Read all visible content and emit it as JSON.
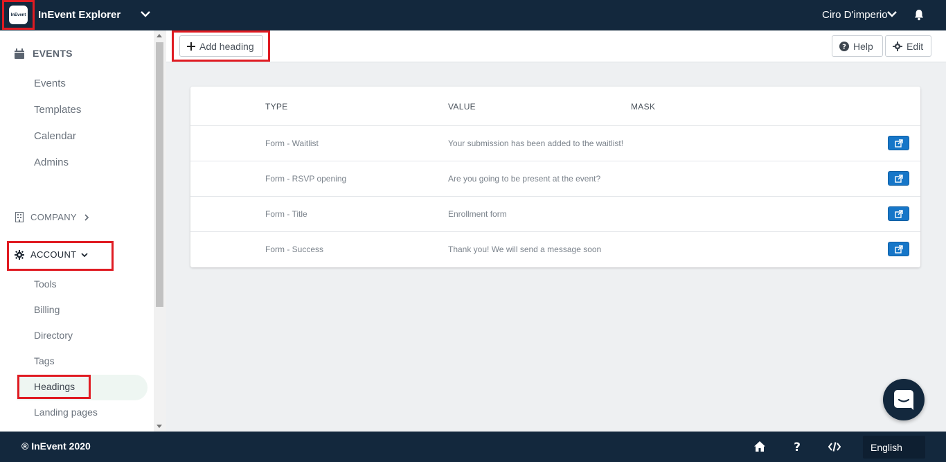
{
  "topbar": {
    "app_name": "InEvent Explorer",
    "logo_text": "InEvent",
    "user_name": "Ciro D'imperio"
  },
  "sidebar": {
    "events_section": "EVENTS",
    "events_items": [
      "Events",
      "Templates",
      "Calendar",
      "Admins"
    ],
    "company_section": "COMPANY",
    "account_section": "ACCOUNT",
    "account_items": [
      "Tools",
      "Billing",
      "Directory",
      "Tags",
      "Headings",
      "Landing pages"
    ],
    "active_item": "Headings"
  },
  "toolbar": {
    "add_label": "Add heading",
    "help_label": "Help",
    "edit_label": "Edit"
  },
  "table": {
    "headers": [
      "TYPE",
      "VALUE",
      "MASK"
    ],
    "rows": [
      {
        "type": "Form - Waitlist",
        "value": "Your submission has been added to the waitlist!",
        "mask": ""
      },
      {
        "type": "Form - RSVP opening",
        "value": "Are you going to be present at the event?",
        "mask": ""
      },
      {
        "type": "Form - Title",
        "value": "Enrollment form",
        "mask": ""
      },
      {
        "type": "Form - Success",
        "value": "Thank you! We will send a message soon",
        "mask": ""
      }
    ]
  },
  "footer": {
    "copyright": "® InEvent 2020",
    "language": "English"
  },
  "colors": {
    "navy": "#13283d",
    "accent_blue": "#1676c8",
    "highlight_red": "#e01b22"
  }
}
